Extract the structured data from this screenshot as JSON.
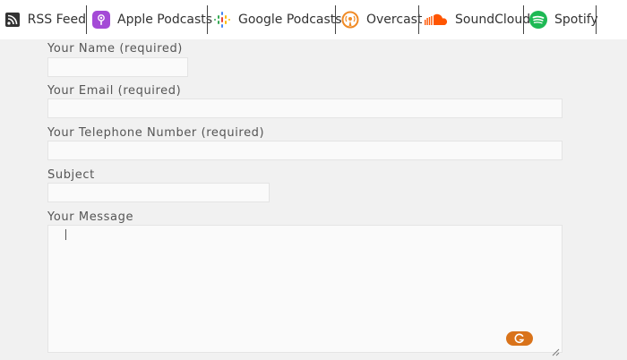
{
  "podcast_links": [
    {
      "label": "RSS Feed",
      "icon": "rss-icon"
    },
    {
      "label": "Apple Podcasts",
      "icon": "apple-podcasts-icon"
    },
    {
      "label": "Google Podcasts",
      "icon": "google-podcasts-icon"
    },
    {
      "label": "Overcast",
      "icon": "overcast-icon"
    },
    {
      "label": "SoundCloud",
      "icon": "soundcloud-icon"
    },
    {
      "label": "Spotify",
      "icon": "spotify-icon"
    }
  ],
  "form": {
    "name_label": "Your Name (required)",
    "name_value": "",
    "email_label": "Your Email (required)",
    "email_value": "",
    "phone_label": "Your Telephone Number (required)",
    "phone_value": "",
    "subject_label": "Subject",
    "subject_value": "",
    "message_label": "Your Message",
    "message_value": ""
  },
  "colors": {
    "apple_podcasts": "#a44ad6",
    "overcast": "#f08a24",
    "soundcloud": "#ff5500",
    "spotify": "#1db954",
    "grammarly_badge": "#d9731a"
  }
}
